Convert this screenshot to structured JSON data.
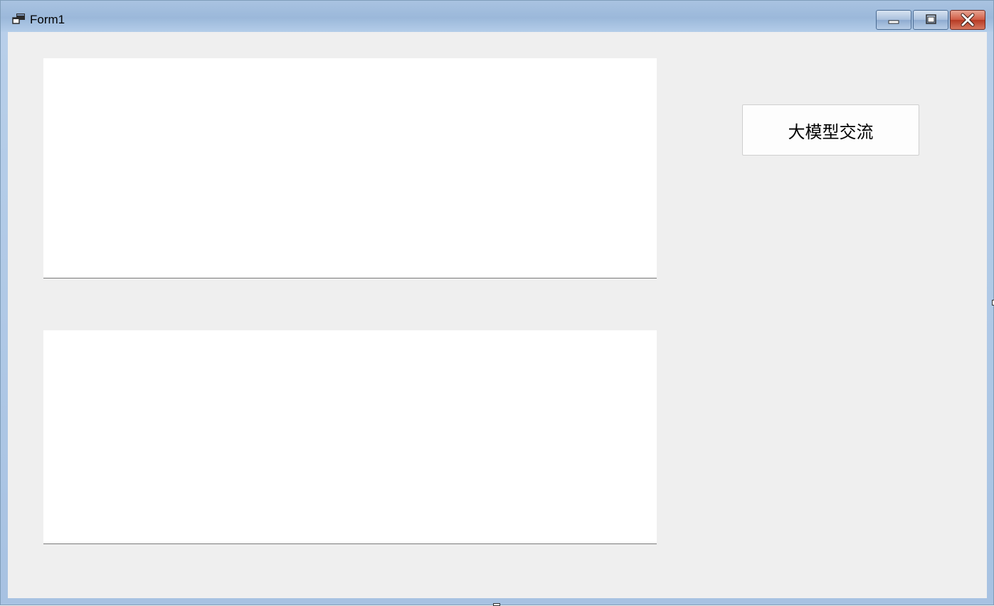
{
  "window": {
    "title": "Form1",
    "icon": "app-window-icon",
    "controls": {
      "minimize": "minimize-icon",
      "maximize": "maximize-icon",
      "close": "close-icon"
    }
  },
  "form": {
    "output_textbox": {
      "value": ""
    },
    "input_textbox": {
      "value": ""
    },
    "action_button": {
      "label": "大模型交流"
    }
  }
}
